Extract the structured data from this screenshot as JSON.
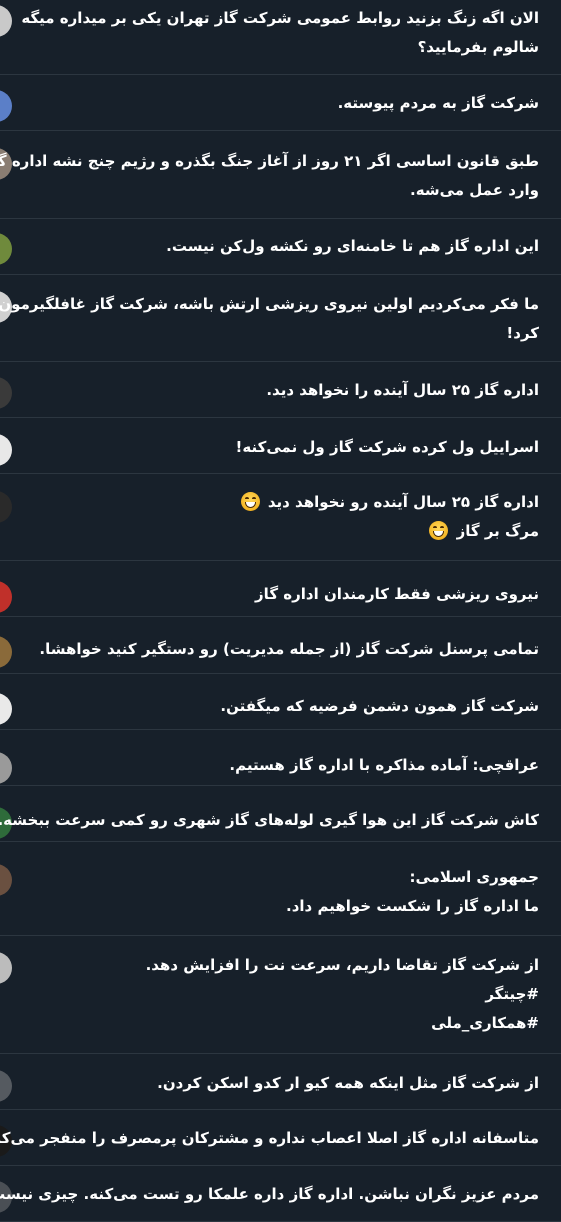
{
  "posts": [
    {
      "lines": [
        "الان اگه زنگ بزنید روابط عمومی شرکت گاز تهران یکی بر میداره میگه",
        "شالوم بفرمایید؟"
      ],
      "avatar_color": "#c9c9c9"
    },
    {
      "lines": [
        "شرکت گاز به مردم پیوسته."
      ],
      "avatar_color": "#5b7fc8"
    },
    {
      "lines": [
        "طبق قانون اساسی اگر ۲۱ روز از آغاز جنگ بگذره و رژیم چنج نشه اداره گاز",
        "وارد عمل می‌شه."
      ],
      "avatar_color": "#8a7d72"
    },
    {
      "lines": [
        "این اداره گاز هم تا خامنه‌ای رو نکشه ول‌کن نیست."
      ],
      "avatar_color": "#6f8a3c"
    },
    {
      "lines": [
        "ما فکر می‌کردیم اولین نیروی ریزشی ارتش باشه، شرکت گاز غافلگیرمون",
        "کرد!"
      ],
      "avatar_color": "#d0d0d0"
    },
    {
      "lines": [
        "اداره گاز ۲۵ سال آینده را نخواهد دید."
      ],
      "avatar_color": "#3a3a3a"
    },
    {
      "lines": [
        "اسراییل ول کرده شرکت گاز ول نمی‌کنه!"
      ],
      "avatar_color": "#e8e8e8"
    },
    {
      "lines": [
        "اداره گاز ۲۵ سال آینده رو نخواهد دید",
        "مرگ بر گاز"
      ],
      "emoji": "grinning-face-emoji",
      "avatar_color": "#2a2a2a"
    },
    {
      "lines": [
        "نیروی ریزشی فقط کارمندان اداره گاز"
      ],
      "avatar_color": "#c0302a"
    },
    {
      "lines": [
        "تمامی پرسنل شرکت گاز (از جمله مدیریت) رو دستگیر کنید خواهشا."
      ],
      "avatar_color": "#8a6a3a"
    },
    {
      "lines": [
        "شرکت گاز همون دشمن فرضیه که میگفتن."
      ],
      "avatar_color": "#e9e9e9"
    },
    {
      "lines": [
        "عراقچی: آماده مذاکره با اداره گاز هستیم."
      ],
      "avatar_color": "#9a9a9a"
    },
    {
      "lines": [
        "کاش شرکت گاز این هوا گیری لوله‌های گاز شهری رو کمی سرعت ببخشه..."
      ],
      "avatar_color": "#2e6b3a"
    },
    {
      "lines": [
        "جمهوری اسلامی:",
        "ما اداره گاز را شکست خواهیم داد."
      ],
      "avatar_color": "#6a5040"
    },
    {
      "lines": [
        "از شرکت گاز تقاضا داریم، سرعت نت را افزایش دهد.",
        "#چیتگر",
        "#همکاری_ملی"
      ],
      "avatar_color": "#bcbcbc"
    },
    {
      "lines": [
        "از شرکت گاز مثل اینکه همه کیو ار کدو اسکن کردن."
      ],
      "avatar_color": "#555a60"
    },
    {
      "lines": [
        "متاسفانه اداره گاز اصلا اعصاب نداره و مشترکان پرمصرف را منفجر می‌کند!"
      ],
      "avatar_color": "#1a1a1a"
    },
    {
      "lines": [
        "مردم عزیز نگران نباشن. اداره گاز داره علمکا رو تست می‌کنه. چیزی نیست."
      ],
      "avatar_color": "#4a4f55"
    }
  ]
}
